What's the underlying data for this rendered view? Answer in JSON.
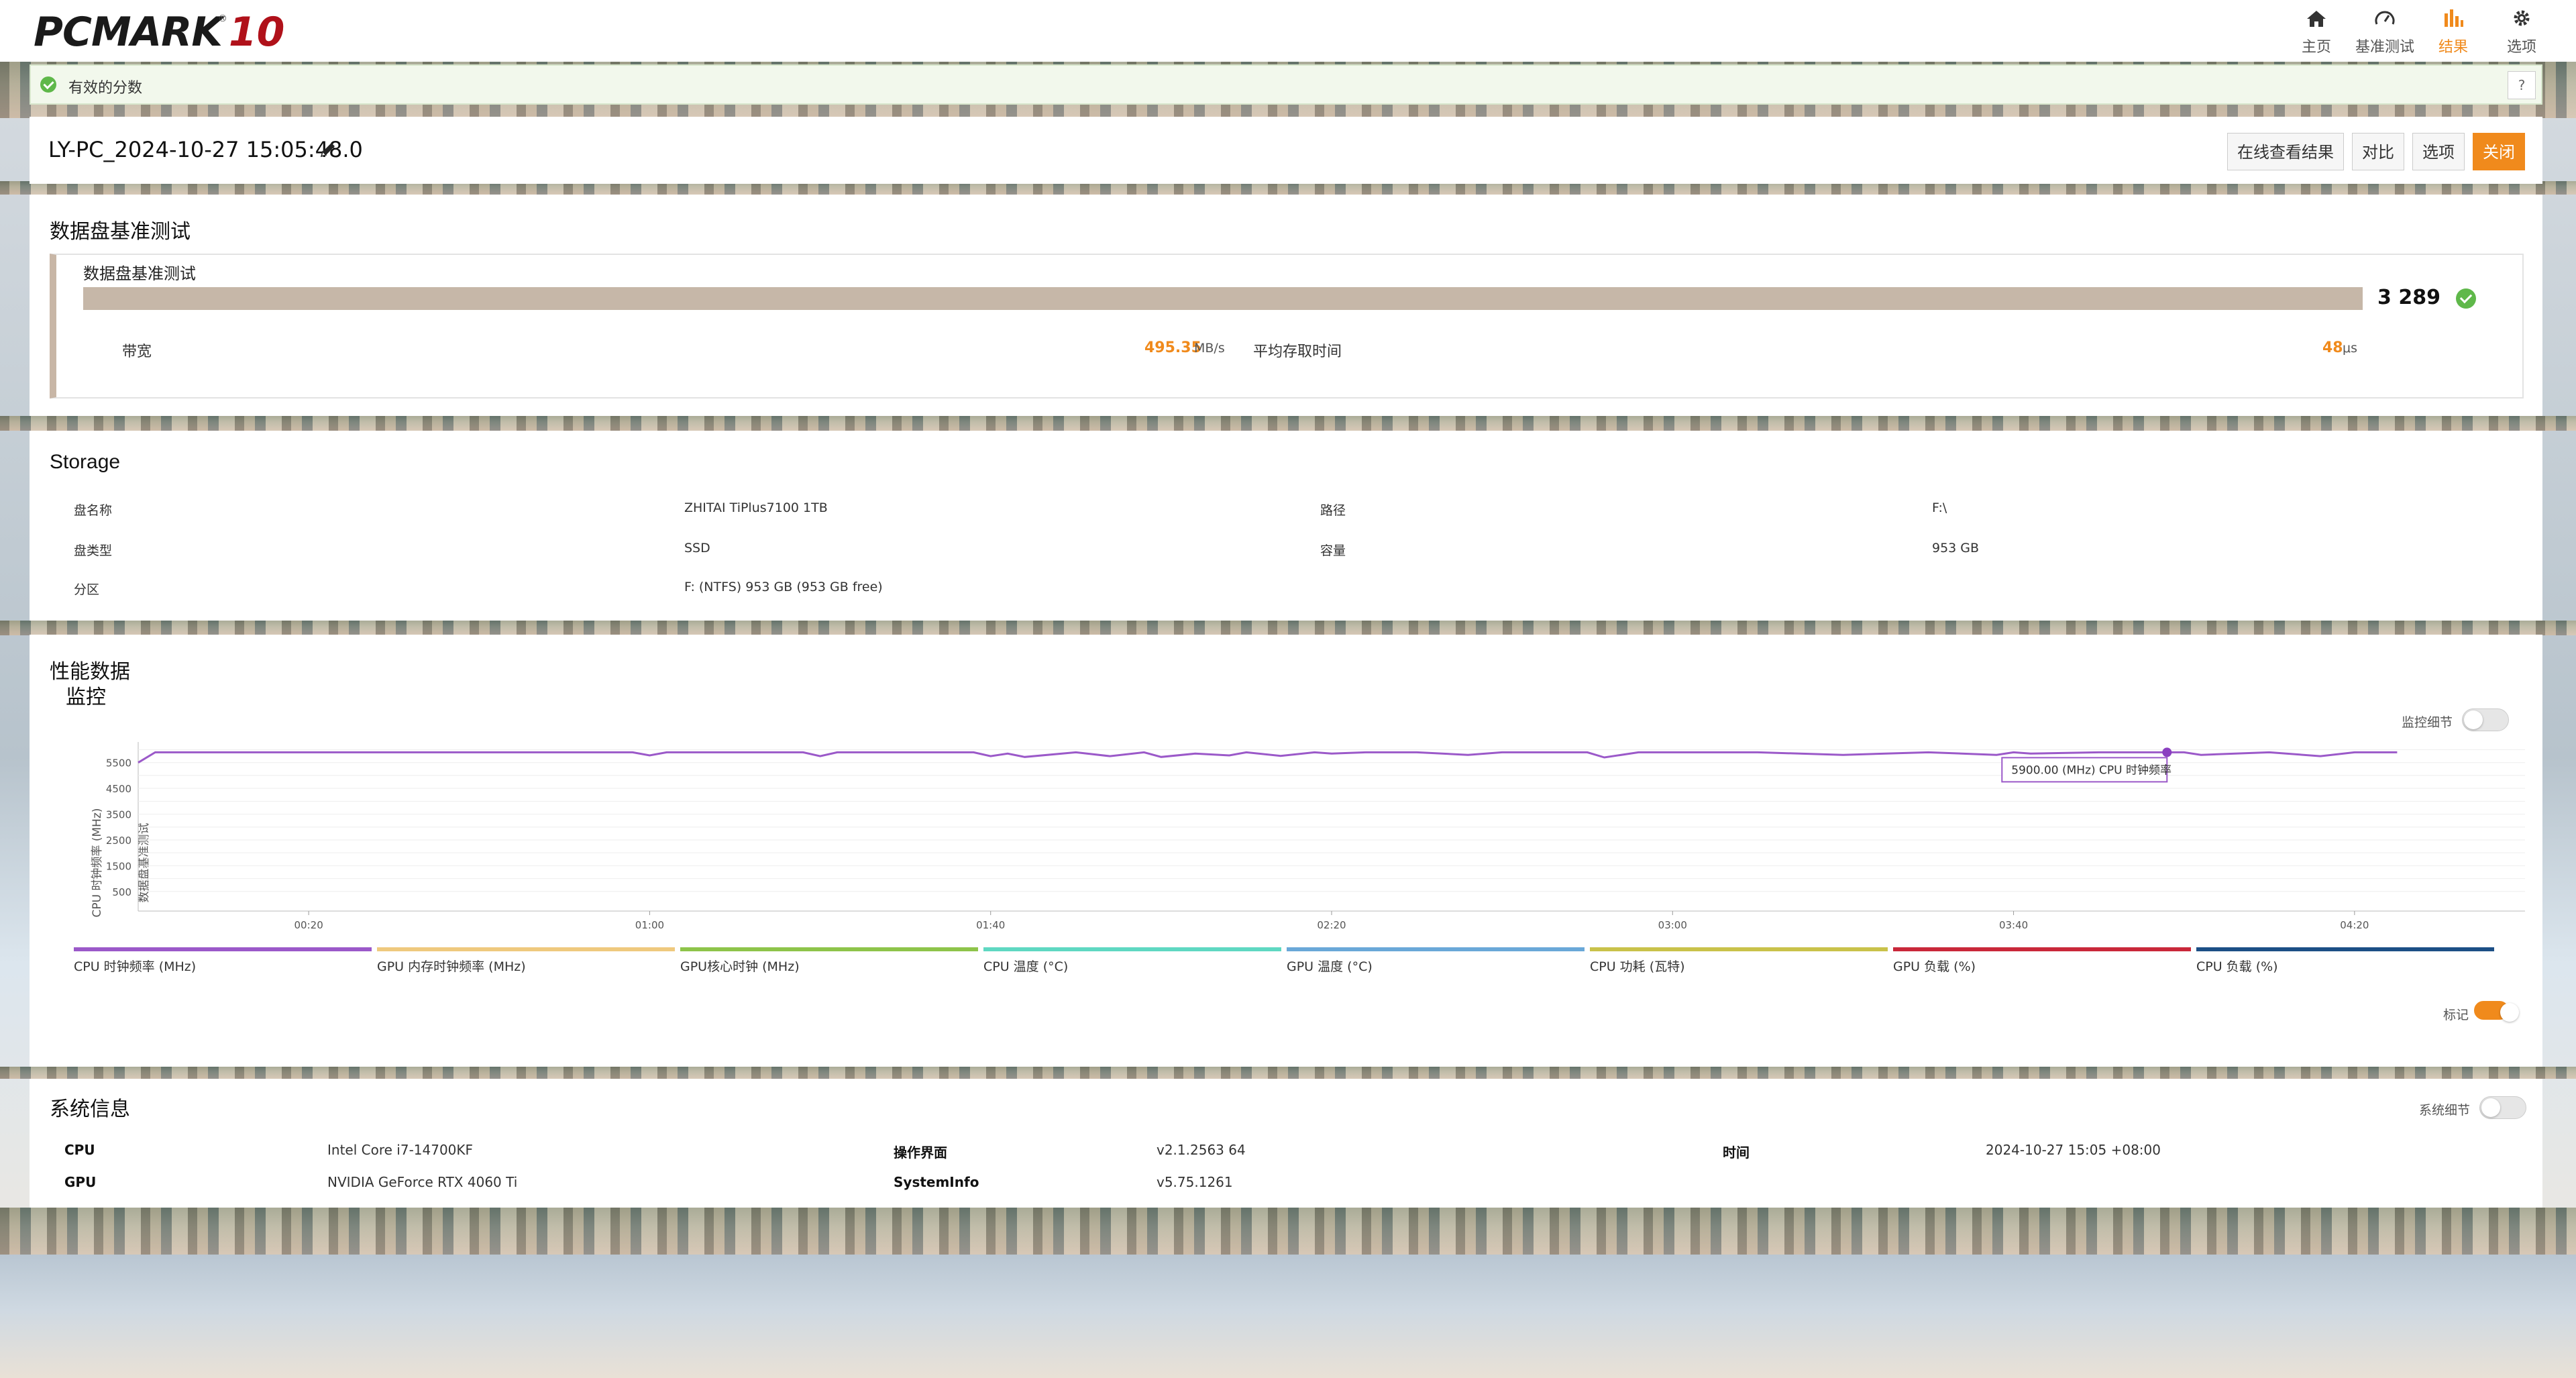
{
  "app": {
    "logo_text": "PCMARK",
    "logo_num": "10",
    "logo_reg": "®"
  },
  "nav": [
    {
      "label": "主页",
      "icon": "home-icon"
    },
    {
      "label": "基准测试",
      "icon": "gauge-icon"
    },
    {
      "label": "结果",
      "icon": "bar-chart-icon",
      "active": true
    },
    {
      "label": "选项",
      "icon": "gear-icon"
    }
  ],
  "valid": {
    "text": "有效的分数",
    "help": "?"
  },
  "result": {
    "name": "LY-PC_2024-10-27 15:05:48.0",
    "buttons": {
      "online": "在线查看结果",
      "compare": "对比",
      "options": "选项",
      "close": "关闭"
    }
  },
  "benchmark": {
    "title": "数据盘基准测试",
    "subtitle": "数据盘基准测试",
    "score": "3 289",
    "bandwidth_label": "带宽",
    "bandwidth_value": "495.35",
    "bandwidth_unit": "MB/s",
    "latency_label": "平均存取时间",
    "latency_value": "48",
    "latency_unit": "μs"
  },
  "storage": {
    "title": "Storage",
    "rows": [
      {
        "k1": "盘名称",
        "v1": "ZHITAI TiPlus7100 1TB",
        "k2": "路径",
        "v2": "F:\\"
      },
      {
        "k1": "盘类型",
        "v1": "SSD",
        "k2": "容量",
        "v2": "953 GB"
      },
      {
        "k1": "分区",
        "v1": "F: (NTFS) 953 GB (953 GB free)",
        "k2": "",
        "v2": ""
      }
    ]
  },
  "performance": {
    "title": "性能数据",
    "monitor_title": "监控",
    "monitor_detail_label": "监控细节",
    "marker_label": "标记",
    "tooltip": "5900.00 (MHz) CPU 时钟频率",
    "ylabel": "CPU 时钟频率 (MHz)",
    "ylabel2": "数据盘基准测试"
  },
  "chart_data": {
    "type": "line",
    "title": "",
    "xlabel": "",
    "ylabel": "CPU 时钟频率 (MHz)",
    "ylim": [
      0,
      6300
    ],
    "xlim": [
      0,
      280
    ],
    "yticks": [
      500,
      1500,
      2500,
      3500,
      4500,
      5500
    ],
    "xticks": [
      {
        "t": 20,
        "label": "00:20"
      },
      {
        "t": 60,
        "label": "01:00"
      },
      {
        "t": 100,
        "label": "01:40"
      },
      {
        "t": 140,
        "label": "02:20"
      },
      {
        "t": 180,
        "label": "03:00"
      },
      {
        "t": 220,
        "label": "03:40"
      },
      {
        "t": 260,
        "label": "04:20"
      }
    ],
    "series": [
      {
        "name": "CPU 时钟频率 (MHz)",
        "color": "#9b59c9",
        "t": [
          0,
          2,
          10,
          20,
          30,
          40,
          50,
          58,
          60,
          62,
          70,
          78,
          80,
          82,
          90,
          98,
          100,
          102,
          104,
          110,
          114,
          118,
          120,
          124,
          128,
          130,
          134,
          138,
          140,
          144,
          150,
          156,
          160,
          170,
          172,
          176,
          180,
          190,
          200,
          210,
          218,
          220,
          222,
          230,
          238,
          240,
          242,
          250,
          256,
          260,
          265
        ],
        "values": [
          5500,
          5900,
          5900,
          5900,
          5900,
          5900,
          5900,
          5900,
          5780,
          5900,
          5900,
          5900,
          5750,
          5900,
          5900,
          5900,
          5750,
          5850,
          5720,
          5900,
          5750,
          5900,
          5720,
          5850,
          5780,
          5900,
          5760,
          5900,
          5850,
          5900,
          5900,
          5800,
          5900,
          5900,
          5700,
          5900,
          5900,
          5900,
          5800,
          5900,
          5800,
          5900,
          5850,
          5900,
          5900,
          5900,
          5800,
          5900,
          5750,
          5900,
          5900
        ]
      }
    ],
    "highlight": {
      "t": 238,
      "value": 5900
    },
    "legend": [
      {
        "name": "CPU 时钟频率 (MHz)",
        "color": "#9b59c9"
      },
      {
        "name": "GPU 内存时钟频率 (MHz)",
        "color": "#efc97e"
      },
      {
        "name": "GPU核心时钟 (MHz)",
        "color": "#8ec44a"
      },
      {
        "name": "CPU 温度 (°C)",
        "color": "#5fd8c2"
      },
      {
        "name": "GPU 温度 (°C)",
        "color": "#6aa8d8"
      },
      {
        "name": "CPU 功耗 (瓦特)",
        "color": "#c9c24a"
      },
      {
        "name": "GPU 负载 (%)",
        "color": "#c9283a"
      },
      {
        "name": "CPU 负载 (%)",
        "color": "#1c4f86"
      }
    ]
  },
  "sysinfo": {
    "title": "系统信息",
    "detail_label": "系统细节",
    "cpu_k": "CPU",
    "cpu_v": "Intel Core i7-14700KF",
    "gpu_k": "GPU",
    "gpu_v": "NVIDIA GeForce RTX 4060 Ti",
    "ui_k": "操作界面",
    "ui_v": "v2.1.2563 64",
    "si_k": "SystemInfo",
    "si_v": "v5.75.1261",
    "time_k": "时间",
    "time_v": "2024-10-27 15:05 +08:00"
  }
}
